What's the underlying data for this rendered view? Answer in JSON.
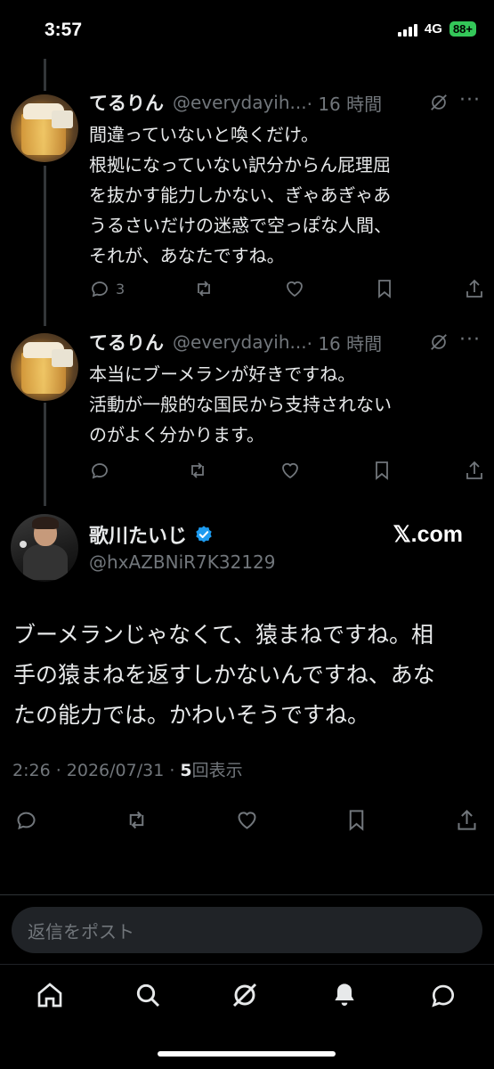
{
  "status": {
    "time": "3:57",
    "network": "4G",
    "battery": "88+"
  },
  "replies": [
    {
      "name": "てるりん",
      "handle": "@everydayih...",
      "time": "· 16 時間",
      "lines": [
        "間違っていないと喚くだけ。",
        "根拠になっていない訳分からん屁理屈",
        "を抜かす能力しかない、ぎゃあぎゃあ",
        "うるさいだけの迷惑で空っぽな人間、",
        "それが、あなたですね。"
      ],
      "reply_count": "3"
    },
    {
      "name": "てるりん",
      "handle": "@everydayih...",
      "time": "· 16 時間",
      "lines": [
        "本当にブーメランが好きですね。",
        "活動が一般的な国民から支持されない",
        "のがよく分かります。"
      ],
      "reply_count": ""
    }
  ],
  "main_post": {
    "name": "歌川たいじ",
    "handle": "@hxAZBNiR7K32129",
    "source": "𝕏.com",
    "lines": [
      "ブーメランじゃなくて、猿まねですね。相",
      "手の猿まねを返すしかないんですね、あな",
      "たの能力では。かわいそうですね。"
    ],
    "meta_prefix": "2:26 · 2026/07/31 · ",
    "views": "5",
    "views_label": "回表示"
  },
  "reply_box": {
    "placeholder": "返信をポスト"
  },
  "icons": {
    "reply": "reply-icon",
    "repost": "repost-icon",
    "like": "like-icon",
    "bookmark": "bookmark-icon",
    "share": "share-icon",
    "grok": "grok-icon",
    "verified": "verified-badge-icon"
  },
  "colors": {
    "background": "#000000",
    "text": "#e7e9ea",
    "secondary": "#71767b",
    "verified": "#1d9bf0",
    "battery": "#34c759"
  }
}
